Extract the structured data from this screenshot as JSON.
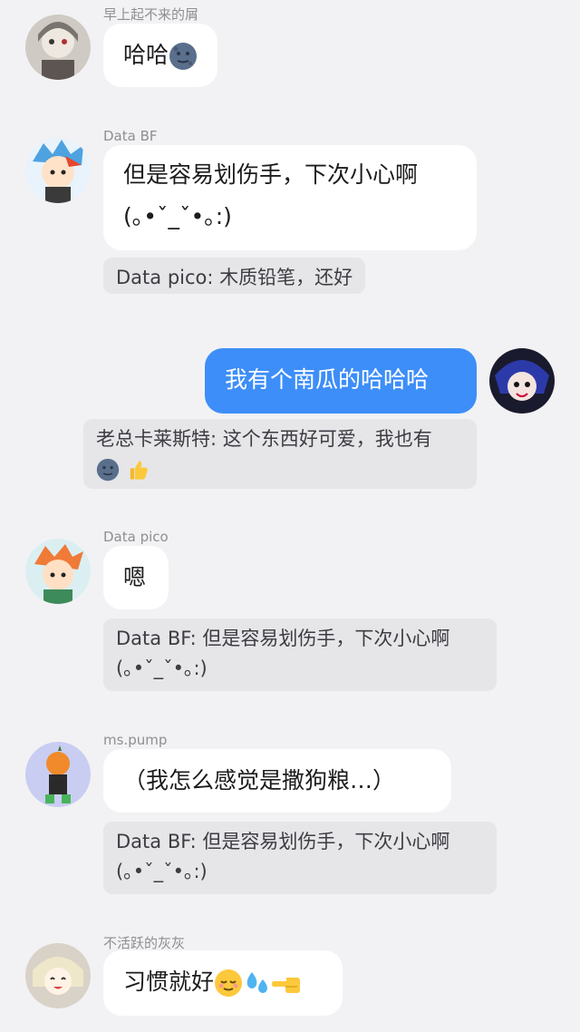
{
  "messages": [
    {
      "sender": "早上起不来的屑",
      "text": "哈哈",
      "emoji": [
        "moon-face"
      ]
    },
    {
      "sender": "Data BF",
      "text_line1": "但是容易划伤手，下次小心啊",
      "text_line2": "(｡•ˇ_ˇ•｡:)",
      "quote": "Data pico: 木质铅笔，还好"
    },
    {
      "self": true,
      "text": "我有个南瓜的哈哈哈",
      "quote": "老总卡莱斯特: 这个东西好可爱，我也有",
      "quote_emoji": [
        "moon-face",
        "thumbs-up"
      ]
    },
    {
      "sender": "Data pico",
      "text": "嗯",
      "quote_line1": "Data BF: 但是容易划伤手，下次小心啊",
      "quote_line2": "(｡•ˇ_ˇ•｡:)"
    },
    {
      "sender": "ms.pump",
      "text": "（我怎么感觉是撒狗粮…）",
      "quote_line1": "Data BF: 但是容易划伤手，下次小心啊",
      "quote_line2": "(｡•ˇ_ˇ•｡:)"
    },
    {
      "sender": "不活跃的灰灰",
      "text": "习惯就好",
      "emoji": [
        "relieved-face",
        "sweat-droplets",
        "pointing-left-hand"
      ]
    }
  ],
  "colors": {
    "background": "#f2f2f4",
    "bubble": "#ffffff",
    "self_bubble": "#3d8ef8",
    "quote_bg": "#e6e6e8",
    "sender_name": "#8e8e93"
  }
}
